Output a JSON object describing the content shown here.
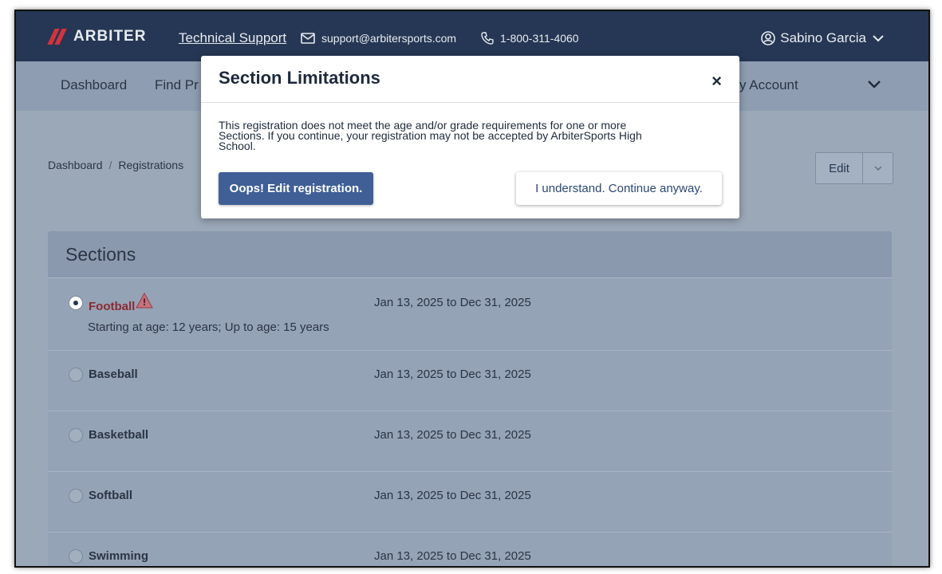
{
  "header": {
    "logo_text": "ARBITER",
    "support_link": "Technical Support",
    "email": "support@arbitersports.com",
    "phone": "1-800-311-4060",
    "user_name": "Sabino Garcia"
  },
  "nav": {
    "items": [
      "Dashboard",
      "Find Pr",
      "nily Account"
    ]
  },
  "breadcrumb": {
    "items": [
      "Dashboard",
      "Registrations"
    ],
    "separator": "/"
  },
  "toolbar": {
    "edit_label": "Edit"
  },
  "sections": {
    "title": "Sections",
    "rows": [
      {
        "name": "Football",
        "date": "Jan 13, 2025 to Dec 31, 2025",
        "sub": "Starting at age: 12 years; Up to age: 15 years",
        "selected": true,
        "warning": true
      },
      {
        "name": "Baseball",
        "date": "Jan 13, 2025 to Dec 31, 2025",
        "selected": false
      },
      {
        "name": "Basketball",
        "date": "Jan 13, 2025 to Dec 31, 2025",
        "selected": false
      },
      {
        "name": "Softball",
        "date": "Jan 13, 2025 to Dec 31, 2025",
        "selected": false
      },
      {
        "name": "Swimming",
        "date": "Jan 13, 2025 to Dec 31, 2025",
        "selected": false
      }
    ]
  },
  "modal": {
    "title": "Section Limitations",
    "close": "×",
    "body_lines": [
      "This registration does not meet the age and/or grade requirements for one or more",
      "Sections. If you continue, your registration may not be accepted by ArbiterSports High",
      "School."
    ],
    "primary_button": "Oops! Edit registration.",
    "secondary_button": "I understand. Continue anyway."
  },
  "colors": {
    "header_bg": "#253754",
    "brand_red": "#d6323c",
    "primary_button": "#3f5f96",
    "warning_text": "#8a2a33"
  }
}
